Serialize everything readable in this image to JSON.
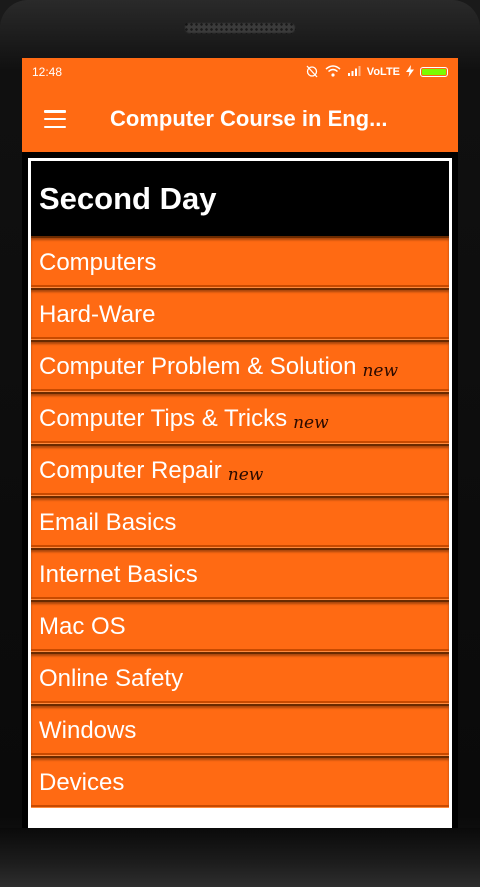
{
  "status": {
    "time": "12:48",
    "network": "VoLTE",
    "icons": [
      "alarm-off-icon",
      "wifi-icon",
      "signal-icon",
      "charging-icon",
      "battery-icon"
    ],
    "battery_color": "#7CFC00"
  },
  "appbar": {
    "title": "Computer Course in Eng...",
    "background": "#ff6a13"
  },
  "section": {
    "title": "Second Day"
  },
  "items": [
    {
      "label": "Computers",
      "badge": ""
    },
    {
      "label": "Hard-Ware",
      "badge": ""
    },
    {
      "label": "Computer Problem & Solution",
      "badge": "new"
    },
    {
      "label": "Computer Tips & Tricks",
      "badge": "new"
    },
    {
      "label": "Computer Repair",
      "badge": "new"
    },
    {
      "label": "Email Basics",
      "badge": ""
    },
    {
      "label": "Internet Basics",
      "badge": ""
    },
    {
      "label": "Mac OS",
      "badge": ""
    },
    {
      "label": "Online Safety",
      "badge": ""
    },
    {
      "label": "Windows",
      "badge": ""
    },
    {
      "label": "Devices",
      "badge": ""
    }
  ]
}
